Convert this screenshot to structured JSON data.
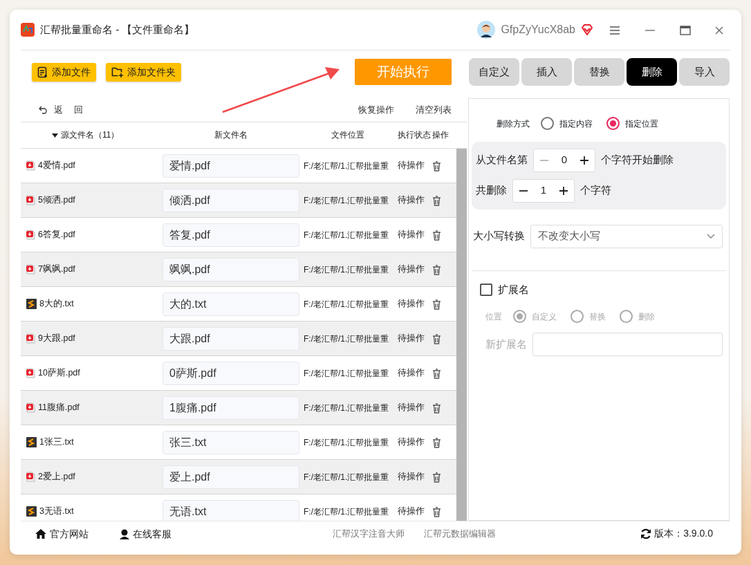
{
  "window": {
    "title": "汇帮批量重命名 - 【文件重命名】",
    "username": "GfpZyYucX8ab"
  },
  "toolbar": {
    "add_file": "添加文件",
    "add_folder": "添加文件夹",
    "start": "开始执行"
  },
  "mode_tabs": [
    {
      "label": "自定义",
      "selected": false
    },
    {
      "label": "插入",
      "selected": false
    },
    {
      "label": "替换",
      "selected": false
    },
    {
      "label": "删除",
      "selected": true
    },
    {
      "label": "导入",
      "selected": false
    }
  ],
  "list_actions": {
    "back": "返 回",
    "restore": "恢复操作",
    "clear": "清空列表"
  },
  "table": {
    "columns": [
      "源文件名（11）",
      "新文件名",
      "文件位置",
      "执行状态",
      "操作"
    ],
    "rows": [
      {
        "source": "4爱情.pdf",
        "kind": "pdf",
        "new_name": "爱情.pdf",
        "location": "F:/老汇帮/1.汇帮批量重",
        "status": "待操作"
      },
      {
        "source": "5倾洒.pdf",
        "kind": "pdf",
        "new_name": "倾洒.pdf",
        "location": "F:/老汇帮/1.汇帮批量重",
        "status": "待操作"
      },
      {
        "source": "6答复.pdf",
        "kind": "pdf",
        "new_name": "答复.pdf",
        "location": "F:/老汇帮/1.汇帮批量重",
        "status": "待操作"
      },
      {
        "source": "7飒飒.pdf",
        "kind": "pdf",
        "new_name": "飒飒.pdf",
        "location": "F:/老汇帮/1.汇帮批量重",
        "status": "待操作"
      },
      {
        "source": "8大的.txt",
        "kind": "txt",
        "new_name": "大的.txt",
        "location": "F:/老汇帮/1.汇帮批量重",
        "status": "待操作"
      },
      {
        "source": "9大跟.pdf",
        "kind": "pdf",
        "new_name": "大跟.pdf",
        "location": "F:/老汇帮/1.汇帮批量重",
        "status": "待操作"
      },
      {
        "source": "10萨斯.pdf",
        "kind": "pdf",
        "new_name": "0萨斯.pdf",
        "location": "F:/老汇帮/1.汇帮批量重",
        "status": "待操作"
      },
      {
        "source": "11腹痛.pdf",
        "kind": "pdf",
        "new_name": "1腹痛.pdf",
        "location": "F:/老汇帮/1.汇帮批量重",
        "status": "待操作"
      },
      {
        "source": "1张三.txt",
        "kind": "txt",
        "new_name": "张三.txt",
        "location": "F:/老汇帮/1.汇帮批量重",
        "status": "待操作"
      },
      {
        "source": "2爱上.pdf",
        "kind": "pdf",
        "new_name": "爱上.pdf",
        "location": "F:/老汇帮/1.汇帮批量重",
        "status": "待操作"
      },
      {
        "source": "3无语.txt",
        "kind": "txt",
        "new_name": "无语.txt",
        "location": "F:/老汇帮/1.汇帮批量重",
        "status": "待操作"
      }
    ]
  },
  "delete_panel": {
    "method_label": "删除方式",
    "methods": [
      {
        "label": "指定内容",
        "selected": false
      },
      {
        "label": "指定位置",
        "selected": true
      }
    ],
    "steppers": [
      {
        "label": "从文件名第",
        "value": "0",
        "suffix": "个字符开始删除",
        "decrement_disabled": true
      },
      {
        "label": "共删除",
        "value": "1",
        "suffix": "个字符",
        "decrement_disabled": false
      }
    ]
  },
  "case": {
    "label": "大小写转换",
    "value": "不改变大小写"
  },
  "extension": {
    "label": "扩展名",
    "checked": false,
    "disabled": true,
    "position_label": "位置",
    "positions": [
      {
        "label": "自定义",
        "selected": true
      },
      {
        "label": "替换",
        "selected": false
      },
      {
        "label": "删除",
        "selected": false
      }
    ],
    "new_label": "新扩展名"
  },
  "footer": {
    "links": [
      "官方网站",
      "在线客服"
    ],
    "tools": [
      "汇帮汉字注音大师",
      "汇帮元数据编辑器"
    ],
    "version": "版本：3.9.0.0"
  }
}
